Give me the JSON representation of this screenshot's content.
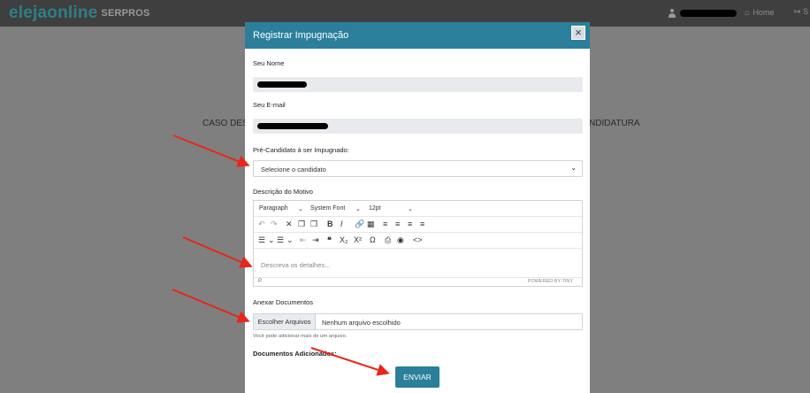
{
  "navbar": {
    "brand_main": "elejaonline",
    "brand_sub": "SERPROS",
    "home_label": "Home",
    "exit_label": "S"
  },
  "background": {
    "text_left": "CASO DESE",
    "text_right": "NDIDATURA"
  },
  "modal": {
    "title": "Registrar Impugnação",
    "close_label": "×",
    "name_label": "Seu Nome",
    "email_label": "Seu E-mail",
    "candidate_label": "Pré-Candidato à ser Impugnado:",
    "candidate_select_value": "Selecione o candidato",
    "reason_label": "Descrição do Motivo",
    "editor": {
      "block_format": "Paragraph",
      "font_family": "System Font",
      "font_size": "12pt",
      "placeholder": "Descreva os detalhes...",
      "status_path": "P",
      "powered_by": "POWERED BY TINY"
    },
    "attach_label": "Anexar Documentos",
    "file_button": "Escolher Arquivos",
    "file_status": "Nenhum arquivo escolhido",
    "file_hint": "Você pode adicionar mais de um arquivo.",
    "docs_added_label": "Documentos Adicionados:",
    "submit_label": "ENVIAR"
  },
  "colors": {
    "accent": "#2b7f9b",
    "navbar": "#3f3f3f",
    "annotation_arrow": "#e8261c"
  }
}
